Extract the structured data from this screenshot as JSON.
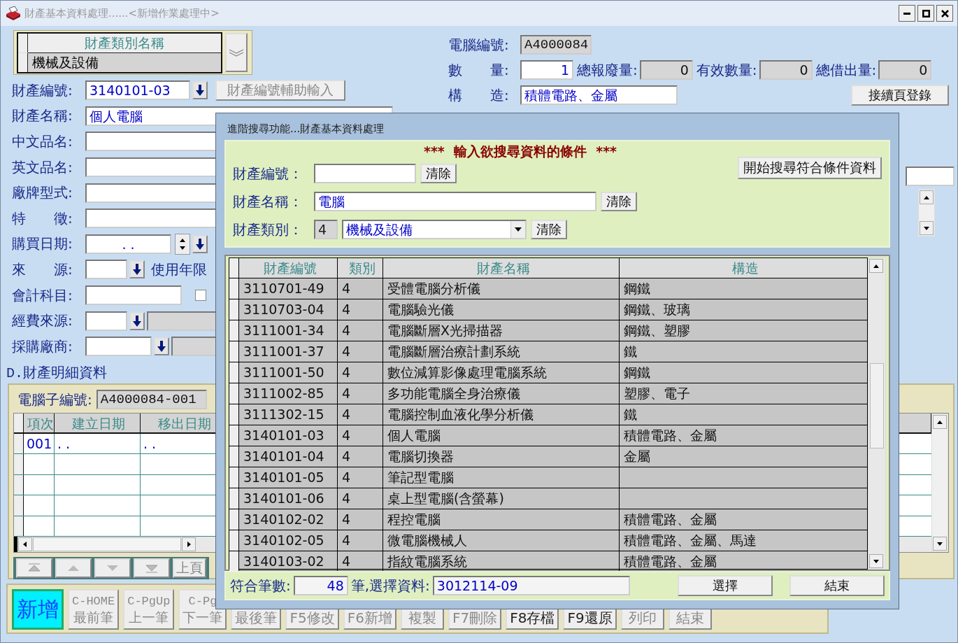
{
  "window": {
    "title": "財產基本資料處理......<新增作業處理中>"
  },
  "category_picker": {
    "header": "財產類別名稱",
    "value": "機械及設備"
  },
  "left_fields": [
    {
      "kind": "code",
      "label": "財產編號:",
      "value": "3140101-03",
      "button": "財產編號輔助輸入"
    },
    {
      "kind": "text",
      "label": "財產名稱:",
      "value": "個人電腦"
    },
    {
      "kind": "text",
      "label": "中文品名:"
    },
    {
      "kind": "text",
      "label": "英文品名:"
    },
    {
      "kind": "text",
      "label": "廠牌型式:"
    },
    {
      "kind": "text",
      "label": "特　　徵:"
    },
    {
      "kind": "date",
      "label": "購買日期:",
      "value": ".   ."
    },
    {
      "kind": "lookup",
      "label": "來　　源:",
      "extra_label": "使用年限"
    },
    {
      "kind": "account",
      "label": "會計科目:",
      "checked": false
    },
    {
      "kind": "lookup_named",
      "label": "經費來源:"
    },
    {
      "kind": "lookup_named",
      "label": "採購廠商:"
    }
  ],
  "right_panel": {
    "computer_no": {
      "label": "電腦編號:",
      "value": "A4000084"
    },
    "quantity": {
      "label": "數　　量:",
      "value": "1"
    },
    "totals": [
      {
        "label": "總報廢量:",
        "value": "0"
      },
      {
        "label": "有效數量:",
        "value": "0"
      },
      {
        "label": "總借出量:",
        "value": "0"
      }
    ],
    "structure": {
      "label": "構　　造:",
      "value": "積體電路、金屬"
    },
    "continue_button": "接續頁登錄"
  },
  "detail": {
    "title": "D.財產明細資料",
    "sub_no": {
      "label": "電腦子編號:",
      "value": "A4000084-001"
    },
    "columns": [
      "項次",
      "建立日期",
      "移出日期"
    ],
    "rows": [
      [
        "001",
        ".   .",
        ".   ."
      ]
    ],
    "page_button": "上頁"
  },
  "toolbar": [
    {
      "label": "新增",
      "selected": true,
      "disabled": false
    },
    {
      "key": "C-HOME",
      "label": "最前筆",
      "selected": false,
      "disabled": true
    },
    {
      "key": "C-PgUp",
      "label": "上一筆",
      "selected": false,
      "disabled": true
    },
    {
      "key": "C-Pg",
      "label": "下一筆",
      "selected": false,
      "disabled": true
    },
    {
      "label": "最後筆",
      "selected": false,
      "disabled": true
    },
    {
      "label": "F5修改",
      "selected": false,
      "disabled": true
    },
    {
      "label": "F6新增",
      "selected": false,
      "disabled": true
    },
    {
      "label": "複製",
      "selected": false,
      "disabled": true
    },
    {
      "label": "F7刪除",
      "selected": false,
      "disabled": true
    },
    {
      "label": "F8存檔",
      "selected": false,
      "disabled": false
    },
    {
      "label": "F9還原",
      "selected": false,
      "disabled": false
    },
    {
      "label": "列印",
      "selected": false,
      "disabled": true
    },
    {
      "label": "結束",
      "selected": false,
      "disabled": true
    }
  ],
  "dialog": {
    "title": "進階搜尋功能...財產基本資料處理",
    "heading": "***  輸入欲搜尋資料的條件  ***",
    "search_button": "開始搜尋符合條件資料",
    "criteria": [
      {
        "kind": "text",
        "label": "財產編號：",
        "clear": "清除"
      },
      {
        "kind": "wide",
        "label": "財產名稱：",
        "value": "電腦",
        "clear": "清除"
      },
      {
        "kind": "select",
        "label": "財產類別：",
        "code": "4",
        "value": "機械及設備",
        "clear": "清除"
      }
    ],
    "columns": [
      "財產編號",
      "類別",
      "財產名稱",
      "構造"
    ],
    "rows": [
      {
        "code": "3110701-49",
        "class": "4",
        "name": "受體電腦分析儀",
        "structure": "鋼鐵"
      },
      {
        "code": "3110703-04",
        "class": "4",
        "name": "電腦驗光儀",
        "structure": "鋼鐵、玻璃"
      },
      {
        "code": "3111001-34",
        "class": "4",
        "name": "電腦斷層X光掃描器",
        "structure": "鋼鐵、塑膠"
      },
      {
        "code": "3111001-37",
        "class": "4",
        "name": "電腦斷層治療計劃系統",
        "structure": "鐵"
      },
      {
        "code": "3111001-50",
        "class": "4",
        "name": "數位減算影像處理電腦系統",
        "structure": "鋼鐵"
      },
      {
        "code": "3111002-85",
        "class": "4",
        "name": "多功能電腦全身治療儀",
        "structure": "塑膠、電子"
      },
      {
        "code": "3111302-15",
        "class": "4",
        "name": "電腦控制血液化學分析儀",
        "structure": "鐵"
      },
      {
        "code": "3140101-03",
        "class": "4",
        "name": "個人電腦",
        "structure": "積體電路、金屬"
      },
      {
        "code": "3140101-04",
        "class": "4",
        "name": "電腦切換器",
        "structure": "金屬"
      },
      {
        "code": "3140101-05",
        "class": "4",
        "name": "筆記型電腦"
      },
      {
        "code": "3140101-06",
        "class": "4",
        "name": "桌上型電腦(含螢幕)"
      },
      {
        "code": "3140102-02",
        "class": "4",
        "name": "程控電腦",
        "structure": "積體電路、金屬"
      },
      {
        "code": "3140102-05",
        "class": "4",
        "name": "微電腦機械人",
        "structure": "積體電路、金屬、馬達"
      },
      {
        "code": "3140103-02",
        "class": "4",
        "name": "指紋電腦系統",
        "structure": "積體電路、金屬"
      }
    ],
    "footer": {
      "count_label": "符合筆數:",
      "count": "48",
      "unit_label": "筆,選擇資料:",
      "selection": "3012114-09",
      "buttons": [
        "選擇",
        "結束"
      ]
    }
  }
}
